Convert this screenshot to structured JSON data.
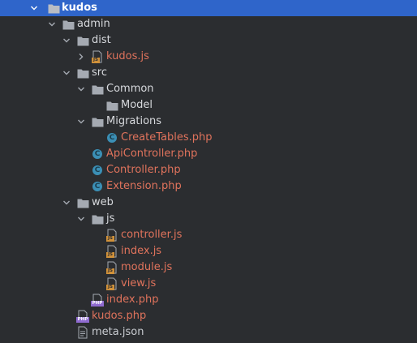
{
  "colors": {
    "background": "#2b2d30",
    "selection": "#2f65ca",
    "folder": "#a5aab2",
    "file_text": "#e0735c",
    "dir_text": "#d7d9dd",
    "php_badge": "#8f6bd0",
    "js_badge": "#d0913a",
    "class_icon": "#3b8fb5"
  },
  "tree": {
    "root": {
      "label": "kudos",
      "icon": "folder-icon",
      "expanded": true
    },
    "admin": {
      "label": "admin",
      "icon": "folder-icon",
      "expanded": true
    },
    "dist": {
      "label": "dist",
      "icon": "folder-icon",
      "expanded": true
    },
    "dist_kudos_js": {
      "label": "kudos.js",
      "icon": "js-file-icon",
      "expanded": false
    },
    "src": {
      "label": "src",
      "icon": "folder-icon",
      "expanded": true
    },
    "common": {
      "label": "Common",
      "icon": "folder-icon",
      "expanded": true
    },
    "model": {
      "label": "Model",
      "icon": "folder-icon"
    },
    "migrations": {
      "label": "Migrations",
      "icon": "folder-icon",
      "expanded": true
    },
    "create_tables": {
      "label": "CreateTables.php",
      "icon": "php-class-icon"
    },
    "api_controller": {
      "label": "ApiController.php",
      "icon": "php-class-icon"
    },
    "controller": {
      "label": "Controller.php",
      "icon": "php-class-icon"
    },
    "extension": {
      "label": "Extension.php",
      "icon": "php-class-icon"
    },
    "web": {
      "label": "web",
      "icon": "folder-icon",
      "expanded": true
    },
    "js": {
      "label": "js",
      "icon": "folder-icon",
      "expanded": true
    },
    "controller_js": {
      "label": "controller.js",
      "icon": "js-file-icon"
    },
    "index_js": {
      "label": "index.js",
      "icon": "js-file-icon"
    },
    "module_js": {
      "label": "module.js",
      "icon": "js-file-icon"
    },
    "view_js": {
      "label": "view.js",
      "icon": "js-file-icon"
    },
    "index_php": {
      "label": "index.php",
      "icon": "php-file-icon"
    },
    "kudos_php": {
      "label": "kudos.php",
      "icon": "php-file-icon"
    },
    "meta_json": {
      "label": "meta.json",
      "icon": "json-file-icon"
    }
  }
}
